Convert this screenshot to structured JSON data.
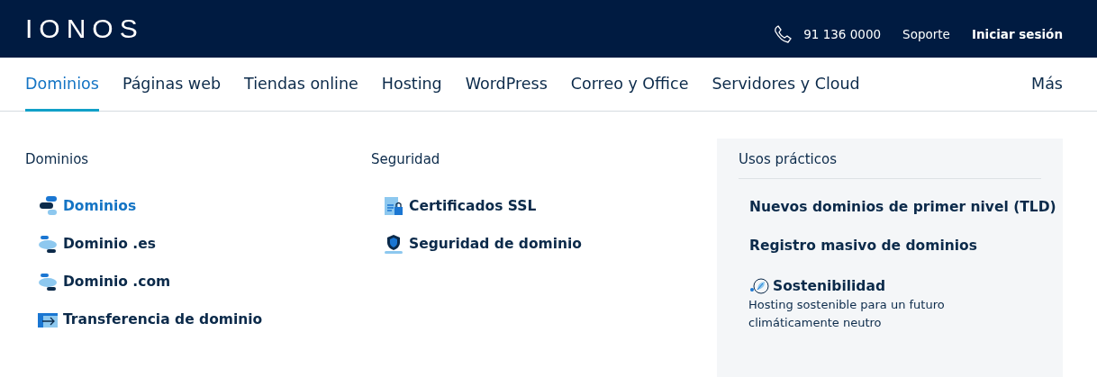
{
  "header": {
    "logo": "IONOS",
    "phone": "91 136 0000",
    "support": "Soporte",
    "login": "Iniciar sesión"
  },
  "nav": {
    "items": [
      {
        "label": "Dominios",
        "selected": true
      },
      {
        "label": "Páginas web",
        "selected": false
      },
      {
        "label": "Tiendas online",
        "selected": false
      },
      {
        "label": "Hosting",
        "selected": false
      },
      {
        "label": "WordPress",
        "selected": false
      },
      {
        "label": "Correo y Office",
        "selected": false
      },
      {
        "label": "Servidores y Cloud",
        "selected": false
      }
    ],
    "more": "Más"
  },
  "menu": {
    "columns": [
      {
        "heading": "Dominios",
        "items": [
          {
            "label": "Dominios",
            "selected": true
          },
          {
            "label": "Dominio .es",
            "selected": false
          },
          {
            "label": "Dominio .com",
            "selected": false
          },
          {
            "label": "Transferencia de dominio",
            "selected": false
          }
        ]
      },
      {
        "heading": "Seguridad",
        "items": [
          {
            "label": "Certificados SSL",
            "selected": false
          },
          {
            "label": "Seguridad de dominio",
            "selected": false
          }
        ]
      }
    ],
    "panel": {
      "heading": "Usos prácticos",
      "links": [
        {
          "label": "Nuevos dominios de primer nivel (TLD)"
        },
        {
          "label": "Registro masivo de dominios"
        },
        {
          "label": "Sostenibilidad",
          "kind": "icon",
          "description": "Hosting sostenible para un futuro climáticamente neutro"
        }
      ]
    }
  }
}
